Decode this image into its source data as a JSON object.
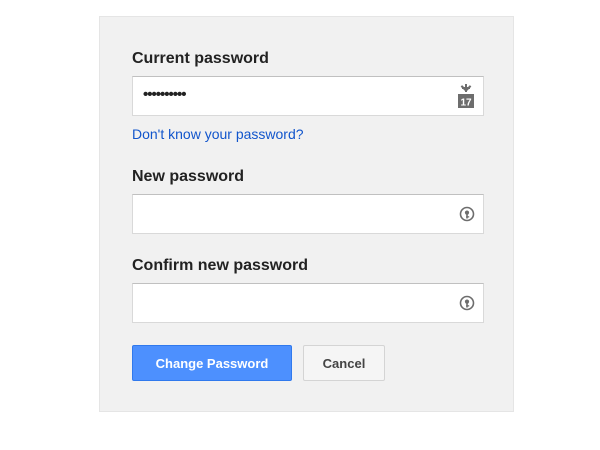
{
  "form": {
    "current_password": {
      "label": "Current password",
      "value": "••••••••••",
      "icon": "calendar-17-icon"
    },
    "forgot_link": "Don't know your password?",
    "new_password": {
      "label": "New password",
      "value": "",
      "icon": "password-generator-icon"
    },
    "confirm_password": {
      "label": "Confirm new password",
      "value": "",
      "icon": "password-generator-icon"
    },
    "change_button": "Change Password",
    "cancel_button": "Cancel"
  },
  "colors": {
    "panel_bg": "#f1f1f1",
    "primary_button": "#4d90fe",
    "link": "#1155cc"
  }
}
